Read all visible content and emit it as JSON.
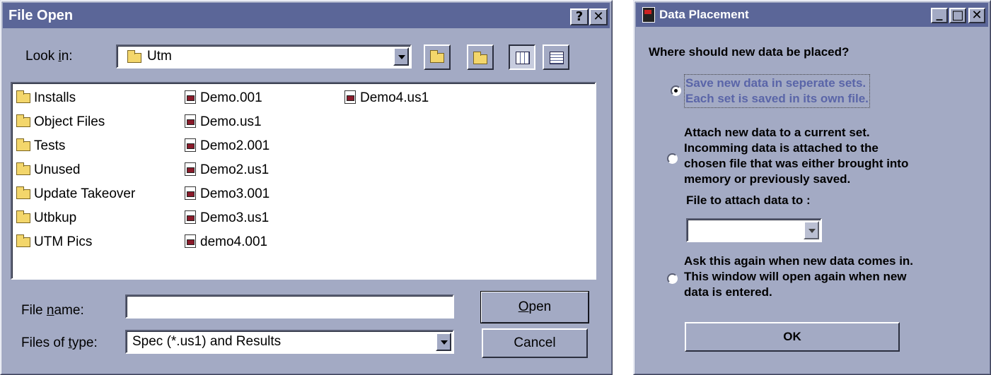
{
  "file_open": {
    "title": "File Open",
    "help_glyph": "?",
    "close_glyph": "✕",
    "look_in_label": "Look in:",
    "look_in_value": "Utm",
    "folders": [
      "Installs",
      "Object Files",
      "Tests",
      "Unused",
      "Update Takeover",
      "Utbkup",
      "UTM Pics"
    ],
    "files_col2": [
      "Demo.001",
      "Demo.us1",
      "Demo2.001",
      "Demo2.us1",
      "Demo3.001",
      "Demo3.us1",
      "demo4.001"
    ],
    "files_col3": [
      "Demo4.us1"
    ],
    "file_name_label": "File name:",
    "file_name_value": "",
    "files_of_type_label": "Files of type:",
    "files_of_type_value": "Spec (*.us1) and Results",
    "open_label": "Open",
    "cancel_label": "Cancel"
  },
  "data_placement": {
    "title": "Data Placement",
    "min_glyph": "_",
    "max_glyph": "□",
    "close_glyph": "✕",
    "question": "Where should new data be placed?",
    "option1": [
      "Save new data in seperate sets.",
      "Each set is saved in its own file."
    ],
    "option2": [
      "Attach new data to a current set.",
      "Incomming data is attached to the",
      "chosen file that was either brought into",
      "memory or previously saved."
    ],
    "attach_label": "File to attach data to :",
    "option3": [
      "Ask this again when new data comes in.",
      "This window will open again when new",
      "data is entered."
    ],
    "ok_label": "OK",
    "selected_option": 1
  }
}
